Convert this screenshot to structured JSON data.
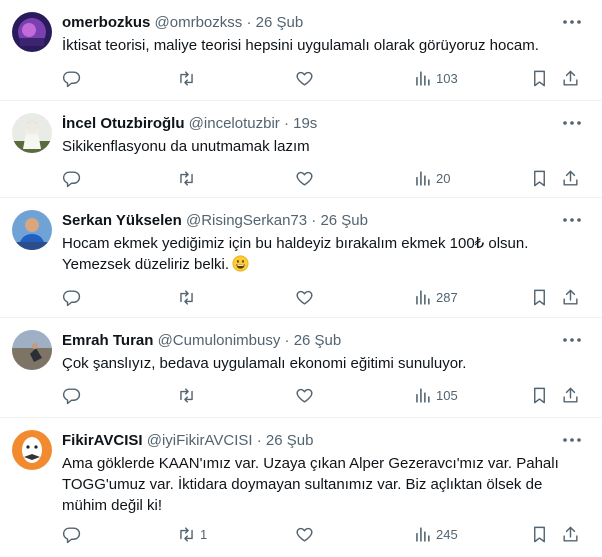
{
  "tweets": [
    {
      "name": "omerbozkus",
      "handle": "@omrbozkss",
      "separator": "·",
      "time": "26 Şub",
      "text": "İktisat teorisi, maliye teorisi hepsini uygulamalı olarak görüyoruz hocam.",
      "emoji": "",
      "replies": "",
      "retweets": "",
      "likes": "",
      "views": "103"
    },
    {
      "name": "İncel Otuzbiroğlu",
      "handle": "@incelotuzbir",
      "separator": "·",
      "time": "19s",
      "text": "Sikikenflasyonu da unutmamak lazım",
      "emoji": "",
      "replies": "",
      "retweets": "",
      "likes": "",
      "views": "20"
    },
    {
      "name": "Serkan Yükselen",
      "handle": "@RisingSerkan73",
      "separator": "·",
      "time": "26 Şub",
      "text": "Hocam ekmek yediğimiz için bu haldeyiz bırakalım ekmek 100₺ olsun. Yemezsek düzeliriz belki.",
      "emoji": "grinning-face",
      "replies": "",
      "retweets": "",
      "likes": "",
      "views": "287"
    },
    {
      "name": "Emrah Turan",
      "handle": "@Cumulonimbusy",
      "separator": "·",
      "time": "26 Şub",
      "text": "Çok şanslıyız, bedava uygulamalı ekonomi eğitimi sunuluyor.",
      "emoji": "",
      "replies": "",
      "retweets": "",
      "likes": "",
      "views": "105"
    },
    {
      "name": "FikirAVCISI",
      "handle": "@iyiFikirAVCISI",
      "separator": "·",
      "time": "26 Şub",
      "text": "Ama göklerde KAAN'ımız var. Uzaya çıkan Alper Gezeravcı'mız var. Pahalı TOGG'umuz var. İktidara doymayan sultanımız var. Biz açlıktan ölsek de mühim değil ki!",
      "emoji": "",
      "replies": "",
      "retweets": "1",
      "likes": "",
      "views": "245"
    }
  ],
  "colors": {
    "text": "#0f1419",
    "secondary": "#536471",
    "divider": "#eff3f4"
  }
}
